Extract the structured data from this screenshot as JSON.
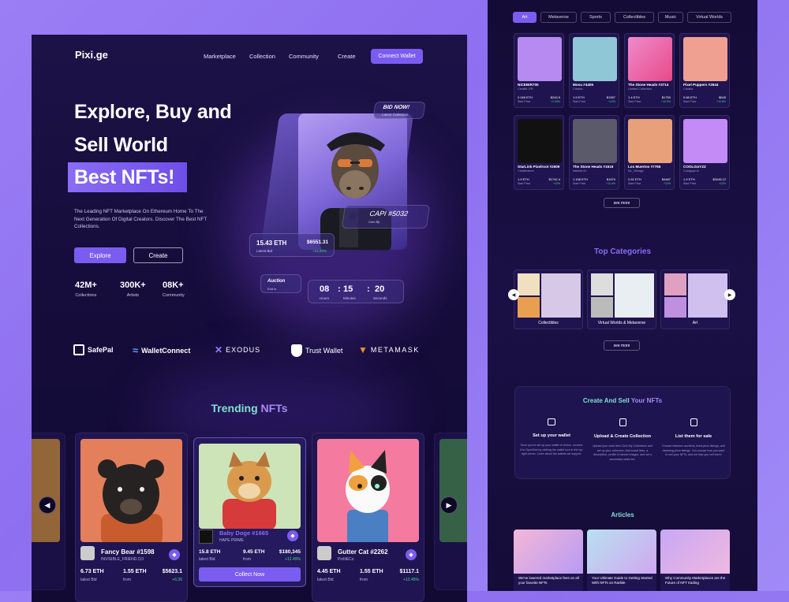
{
  "brand": "Pixi.ge",
  "nav": {
    "links": [
      "Marketplace",
      "Collection",
      "Community",
      "Create"
    ],
    "cta": "Connect Wallet"
  },
  "hero": {
    "line1": "Explore, Buy and",
    "line2": "Sell World",
    "highlight": "Best NFTs!",
    "subtitle": "The Leading NFT Marketplace On Ethereum Home To The Next Generation Of Digital Creators. Discover The Best NFT Collections.",
    "btn_explore": "Explore",
    "btn_create": "Create",
    "stats": [
      {
        "value": "42M+",
        "label": "Collections"
      },
      {
        "value": "300K+",
        "label": "Artists"
      },
      {
        "value": "08K+",
        "label": "Community"
      }
    ],
    "bid_now": "BID NOW!",
    "bid_sub": "Latest Collection",
    "capi_name": "CAPI #5032",
    "capi_sub": "Coin flip",
    "eth_value": "15.43 ETH",
    "eth_label": "Latest Bid",
    "usd_value": "$6551.31",
    "usd_change": "+14.03%",
    "auction": "Auction",
    "auction_sub": "End in",
    "timer": [
      {
        "value": "08",
        "label": "Hours"
      },
      {
        "value": "15",
        "label": "Minutes"
      },
      {
        "value": "20",
        "label": "Seconds"
      }
    ]
  },
  "wallets": [
    "SafePal",
    "WalletConnect",
    "EXODUS",
    "Trust Wallet",
    "METAMASK"
  ],
  "trending": {
    "title_a": "Trending ",
    "title_b": "NFTs",
    "cards": [
      {
        "name": "Fancy Bear #1598",
        "creator": "INVISIBLE_FRIEND.CO",
        "eth": "6.73 ETH",
        "eth_label": "latest Bid",
        "eth2": "1.55 ETH",
        "eth2_label": "from",
        "usd": "$5623.1",
        "change": "+6.36"
      },
      {
        "name": "Baby Doge #1665",
        "creator": "HAPE PRIME",
        "eth": "15.8 ETH",
        "eth_label": "latest Bid",
        "eth2": "9.45 ETH",
        "eth2_label": "from",
        "usd": "$180,345",
        "change": "+12.49%",
        "cta": "Collect Now"
      },
      {
        "name": "Gutter Cat #2262",
        "creator": "PixItiECo",
        "eth": "4.45 ETH",
        "eth_label": "latest Bid",
        "eth2": "1.55 ETH",
        "eth2_label": "from",
        "usd": "$1117.1",
        "change": "+12.45%"
      }
    ]
  },
  "right": {
    "tabs": [
      "Art",
      "Metaverse",
      "Sports",
      "Collectibles",
      "Music",
      "Virtual Worlds"
    ],
    "collections": [
      {
        "name": "NICEBIR700",
        "sub": "Creatib..ER",
        "eth": "2.045 ETH",
        "eth_l": "Start Price",
        "usd": "$245.5",
        "chg": "+2.30%"
      },
      {
        "name": "Mosu #4405",
        "sub": "Creator..",
        "eth": "1.5 ETH",
        "eth_l": "Start Price",
        "usd": "$1557",
        "chg": "+12%"
      },
      {
        "name": "The Stone Heads #3714",
        "sub": "Limited Collection",
        "eth": "1.4 ETH",
        "eth_l": "Start Price",
        "usd": "$1750",
        "chg": "+12.5%"
      },
      {
        "name": "Pixel Puppers #2644",
        "sub": "Creator",
        "eth": "0.88 ETH",
        "eth_l": "Start Price",
        "usd": "$545",
        "chg": "+12.8%"
      },
      {
        "name": "StarLink Pixelroot #2609",
        "sub": "Creatinators",
        "eth": "1.9 ETH",
        "eth_l": "Start Price",
        "usd": "$1742.4",
        "chg": "+12%"
      },
      {
        "name": "The Stone Heads #1619",
        "sub": "Istrieds 0x",
        "eth": "1.158 ETH",
        "eth_l": "Start Price",
        "usd": "$1670",
        "chg": "+12.4%"
      },
      {
        "name": "Los Muertos #7765",
        "sub": "NL_Vintage",
        "eth": "2.52 ETH",
        "eth_l": "Start Price",
        "usd": "$4487",
        "chg": "+12%"
      },
      {
        "name": "COOLGUYZZ",
        "sub": "Coolguyz.io",
        "eth": "1.9 ETH",
        "eth_l": "Start Price",
        "usd": "$3045.12",
        "chg": "+12%"
      }
    ],
    "see_more": "see more",
    "categories_title": "Top Categories",
    "categories": [
      "Collectibles",
      "Virtual Worlds & Metaverse",
      "Art"
    ],
    "create_sell": {
      "title_a": "Create And Sell ",
      "title_b": "Your NFTs",
      "steps": [
        {
          "title": "Set up your wallet",
          "desc": "Once you've set up your wallet of choice, connect it to OpenSea by clicking the wallet icon in the top right corner. Learn about the wallets we support."
        },
        {
          "title": "Upload & Create Collection",
          "desc": "Upload your work then Click My Collections and set up your collection. Add social links, a description, profile & banner images, and set a secondary sales fee."
        },
        {
          "title": "List them for sale",
          "desc": "Choose between auctions, fixed-price listings, and declining-price listings. You choose how you want to sell your NFTs, and we help you sell them!"
        }
      ]
    },
    "articles_title": "Articles",
    "articles": [
      "We've lowered marketplace fees on all your favorite NFTs",
      "Your Ultimate Guide to Getting Started With NFTs on Rarible",
      "Why Community Marketplaces are the Future of NFT trading"
    ]
  },
  "colors": {
    "accent": "#7b5cf0",
    "bg_dark": "#160d3c",
    "green": "#3ddc84",
    "teal": "#7fe0d0"
  }
}
